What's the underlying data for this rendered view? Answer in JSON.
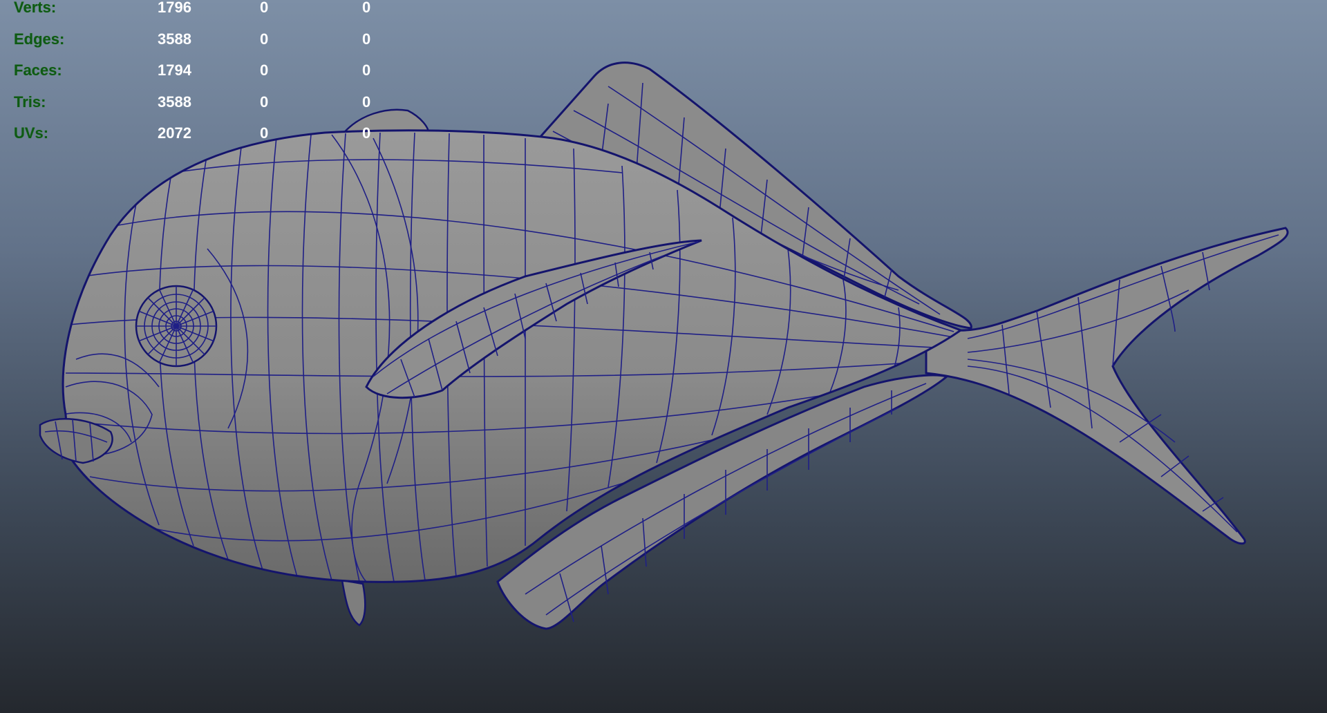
{
  "heads_up_display": {
    "rows": [
      {
        "label": "Verts:",
        "values": [
          "1796",
          "0",
          "0"
        ]
      },
      {
        "label": "Edges:",
        "values": [
          "3588",
          "0",
          "0"
        ]
      },
      {
        "label": "Faces:",
        "values": [
          "1794",
          "0",
          "0"
        ]
      },
      {
        "label": "Tris:",
        "values": [
          "3588",
          "0",
          "0"
        ]
      },
      {
        "label": "UVs:",
        "values": [
          "2072",
          "0",
          "0"
        ]
      }
    ]
  },
  "colors": {
    "viewport_top": "#7d8fa6",
    "viewport_bottom": "#24282e",
    "hud_label": "#0e5a14",
    "hud_value": "#ffffff",
    "mesh_fill": "#8a8a8a",
    "wireframe": "#1f1f86"
  },
  "scene": {
    "object": "fish-mesh",
    "display_mode": "wireframe-on-shaded"
  }
}
